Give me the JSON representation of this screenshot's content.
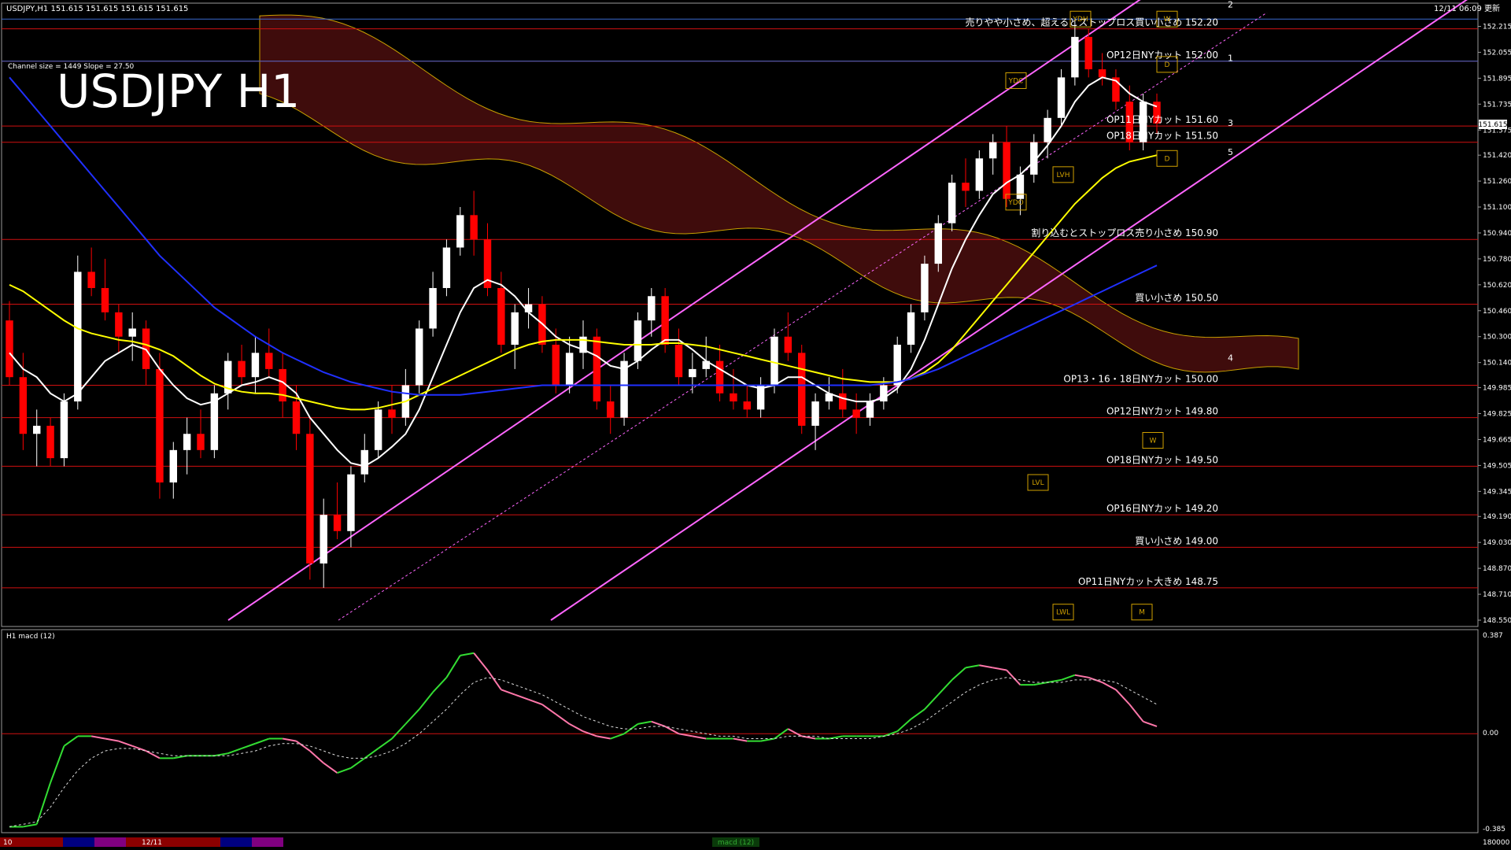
{
  "header": {
    "symbol_info": "USDJPY,H1  151.615 151.615 151.615 151.615",
    "timestamp": "12/11 06:09 更新",
    "channel_info": "Channel size = 1449 Slope = 27.50",
    "big_title": "USDJPY H1"
  },
  "current_price_tag": "151.615",
  "colors": {
    "background": "#000000",
    "bull_candle": "#ffffff",
    "bear_candle": "#ff0000",
    "sma_white": "#ffffff",
    "sma_yellow": "#ffff00",
    "sma_blue": "#2030ff",
    "channel": "#ff66ff",
    "hline": "#d01010",
    "macd_up": "#33dd33",
    "macd_down": "#ff77aa",
    "signal": "#dddddd",
    "kumo": "#8b1a1a"
  },
  "annotations": [
    {
      "label": "売りやや小さめ、超えるとストップロス買い小さめ 152.20",
      "price": 152.2
    },
    {
      "label": "OP12日NYカット 152.00",
      "price": 152.0
    },
    {
      "label": "OP11日NYカット 151.60",
      "price": 151.6
    },
    {
      "label": "OP18日NYカット 151.50",
      "price": 151.5
    },
    {
      "label": "割り込むとストップロス売り小さめ 150.90",
      "price": 150.9
    },
    {
      "label": "買い小さめ 150.50",
      "price": 150.5
    },
    {
      "label": "OP13・16・18日NYカット 150.00",
      "price": 150.0
    },
    {
      "label": "OP12日NYカット 149.80",
      "price": 149.8
    },
    {
      "label": "OP18日NYカット 149.50",
      "price": 149.5
    },
    {
      "label": "OP16日NYカット 149.20",
      "price": 149.2
    },
    {
      "label": "買い小さめ 149.00",
      "price": 149.0
    },
    {
      "label": "OP11日NYカット大きめ 148.75",
      "price": 148.75
    }
  ],
  "level_markers": [
    {
      "label": "YDH",
      "price": 152.26
    },
    {
      "label": "W",
      "price": 152.26
    },
    {
      "label": "YDC",
      "price": 151.88
    },
    {
      "label": "D",
      "price": 151.98
    },
    {
      "label": "LVH",
      "price": 151.3
    },
    {
      "label": "YDO",
      "price": 151.13
    },
    {
      "label": "D",
      "price": 151.4
    },
    {
      "label": "W",
      "price": 149.66
    },
    {
      "label": "LVL",
      "price": 149.4
    },
    {
      "label": "LWL",
      "price": 148.6
    },
    {
      "label": "M",
      "price": 148.6
    }
  ],
  "fib_numbers": [
    {
      "label": "2",
      "price": 152.35
    },
    {
      "label": "1",
      "price": 152.02
    },
    {
      "label": "3",
      "price": 151.62
    },
    {
      "label": "5",
      "price": 151.44
    },
    {
      "label": "4",
      "price": 150.17
    }
  ],
  "macd_panel": {
    "label": "H1  macd (12)",
    "top_value": "0.387",
    "zero_value": "0.00",
    "bottom_value": "-0.385"
  },
  "bottom_bar": {
    "left_date": "10",
    "mid_date": "12/11",
    "center_label": "macd (12)",
    "right_value": "180000"
  },
  "chart_data": {
    "type": "candlestick",
    "title": "USDJPY H1",
    "ylim": [
      148.55,
      152.3
    ],
    "price_ticks": [
      "152.215",
      "152.055",
      "151.895",
      "151.735",
      "151.575",
      "151.420",
      "151.260",
      "151.100",
      "150.940",
      "150.780",
      "150.620",
      "150.460",
      "150.300",
      "150.140",
      "149.985",
      "149.825",
      "149.665",
      "149.505",
      "149.345",
      "149.190",
      "149.030",
      "148.870",
      "148.710",
      "148.550"
    ],
    "candles": [
      [
        150.4,
        150.52,
        150.0,
        150.05
      ],
      [
        150.05,
        150.2,
        149.6,
        149.7
      ],
      [
        149.7,
        149.85,
        149.5,
        149.75
      ],
      [
        149.75,
        149.8,
        149.5,
        149.55
      ],
      [
        149.55,
        149.95,
        149.5,
        149.9
      ],
      [
        149.9,
        150.8,
        149.85,
        150.7
      ],
      [
        150.7,
        150.85,
        150.55,
        150.6
      ],
      [
        150.6,
        150.78,
        150.4,
        150.45
      ],
      [
        150.45,
        150.5,
        150.2,
        150.3
      ],
      [
        150.3,
        150.45,
        150.15,
        150.35
      ],
      [
        150.35,
        150.4,
        150.0,
        150.1
      ],
      [
        150.1,
        150.2,
        149.3,
        149.4
      ],
      [
        149.4,
        149.65,
        149.3,
        149.6
      ],
      [
        149.6,
        149.8,
        149.45,
        149.7
      ],
      [
        149.7,
        149.85,
        149.55,
        149.6
      ],
      [
        149.6,
        150.0,
        149.55,
        149.95
      ],
      [
        149.95,
        150.2,
        149.85,
        150.15
      ],
      [
        150.15,
        150.25,
        150.0,
        150.05
      ],
      [
        150.05,
        150.3,
        149.95,
        150.2
      ],
      [
        150.2,
        150.35,
        150.05,
        150.1
      ],
      [
        150.1,
        150.2,
        149.8,
        149.9
      ],
      [
        149.9,
        150.0,
        149.6,
        149.7
      ],
      [
        149.7,
        149.8,
        148.8,
        148.9
      ],
      [
        148.9,
        149.3,
        148.75,
        149.2
      ],
      [
        149.2,
        149.4,
        149.05,
        149.1
      ],
      [
        149.1,
        149.5,
        149.0,
        149.45
      ],
      [
        149.45,
        149.7,
        149.4,
        149.6
      ],
      [
        149.6,
        149.9,
        149.55,
        149.85
      ],
      [
        149.85,
        150.0,
        149.7,
        149.8
      ],
      [
        149.8,
        150.1,
        149.75,
        150.0
      ],
      [
        150.0,
        150.4,
        149.95,
        150.35
      ],
      [
        150.35,
        150.7,
        150.3,
        150.6
      ],
      [
        150.6,
        150.9,
        150.55,
        150.85
      ],
      [
        150.85,
        151.1,
        150.8,
        151.05
      ],
      [
        151.05,
        151.2,
        150.8,
        150.9
      ],
      [
        150.9,
        151.0,
        150.55,
        150.6
      ],
      [
        150.6,
        150.7,
        150.2,
        150.25
      ],
      [
        150.25,
        150.5,
        150.1,
        150.45
      ],
      [
        150.45,
        150.6,
        150.35,
        150.5
      ],
      [
        150.5,
        150.55,
        150.2,
        150.25
      ],
      [
        150.25,
        150.35,
        149.95,
        150.0
      ],
      [
        150.0,
        150.3,
        149.95,
        150.2
      ],
      [
        150.2,
        150.4,
        150.1,
        150.3
      ],
      [
        150.3,
        150.35,
        149.85,
        149.9
      ],
      [
        149.9,
        150.0,
        149.7,
        149.8
      ],
      [
        149.8,
        150.2,
        149.75,
        150.15
      ],
      [
        150.15,
        150.45,
        150.1,
        150.4
      ],
      [
        150.4,
        150.6,
        150.3,
        150.55
      ],
      [
        150.55,
        150.6,
        150.2,
        150.25
      ],
      [
        150.25,
        150.35,
        150.0,
        150.05
      ],
      [
        150.05,
        150.2,
        149.95,
        150.1
      ],
      [
        150.1,
        150.3,
        150.05,
        150.15
      ],
      [
        150.15,
        150.25,
        149.9,
        149.95
      ],
      [
        149.95,
        150.1,
        149.85,
        149.9
      ],
      [
        149.9,
        150.0,
        149.8,
        149.85
      ],
      [
        149.85,
        150.05,
        149.8,
        150.0
      ],
      [
        150.0,
        150.35,
        149.95,
        150.3
      ],
      [
        150.3,
        150.45,
        150.15,
        150.2
      ],
      [
        150.2,
        150.25,
        149.7,
        149.75
      ],
      [
        149.75,
        149.95,
        149.6,
        149.9
      ],
      [
        149.9,
        150.05,
        149.85,
        149.95
      ],
      [
        149.95,
        150.1,
        149.8,
        149.85
      ],
      [
        149.85,
        149.95,
        149.7,
        149.8
      ],
      [
        149.8,
        149.95,
        149.75,
        149.9
      ],
      [
        149.9,
        150.05,
        149.85,
        150.0
      ],
      [
        150.0,
        150.3,
        149.95,
        150.25
      ],
      [
        150.25,
        150.5,
        150.2,
        150.45
      ],
      [
        150.45,
        150.8,
        150.4,
        150.75
      ],
      [
        150.75,
        151.05,
        150.7,
        151.0
      ],
      [
        151.0,
        151.3,
        150.95,
        151.25
      ],
      [
        151.25,
        151.4,
        151.1,
        151.2
      ],
      [
        151.2,
        151.45,
        151.15,
        151.4
      ],
      [
        151.4,
        151.55,
        151.3,
        151.5
      ],
      [
        151.5,
        151.6,
        151.1,
        151.15
      ],
      [
        151.15,
        151.35,
        151.05,
        151.3
      ],
      [
        151.3,
        151.55,
        151.25,
        151.5
      ],
      [
        151.5,
        151.7,
        151.4,
        151.65
      ],
      [
        151.65,
        151.95,
        151.6,
        151.9
      ],
      [
        151.9,
        152.25,
        151.85,
        152.15
      ],
      [
        152.15,
        152.2,
        151.9,
        151.95
      ],
      [
        151.95,
        152.05,
        151.85,
        151.9
      ],
      [
        151.9,
        151.95,
        151.7,
        151.75
      ],
      [
        151.75,
        151.85,
        151.45,
        151.5
      ],
      [
        151.5,
        151.8,
        151.45,
        151.75
      ],
      [
        151.75,
        151.8,
        151.55,
        151.615
      ]
    ],
    "series": [
      {
        "name": "",
        "color": "#ffffff",
        "values": [
          150.2,
          150.1,
          150.05,
          149.95,
          149.9,
          149.95,
          150.05,
          150.15,
          150.2,
          150.25,
          150.22,
          150.1,
          150.0,
          149.92,
          149.88,
          149.9,
          149.95,
          150.0,
          150.02,
          150.05,
          150.02,
          149.95,
          149.8,
          149.7,
          149.6,
          149.52,
          149.5,
          149.55,
          149.62,
          149.7,
          149.85,
          150.05,
          150.25,
          150.45,
          150.6,
          150.65,
          150.62,
          150.55,
          150.45,
          150.38,
          150.3,
          150.25,
          150.22,
          150.18,
          150.12,
          150.1,
          150.15,
          150.22,
          150.28,
          150.28,
          150.22,
          150.15,
          150.1,
          150.05,
          150.0,
          149.98,
          150.0,
          150.05,
          150.05,
          150.0,
          149.95,
          149.92,
          149.9,
          149.9,
          149.92,
          149.98,
          150.1,
          150.28,
          150.5,
          150.72,
          150.9,
          151.05,
          151.18,
          151.25,
          151.3,
          151.38,
          151.48,
          151.6,
          151.75,
          151.85,
          151.9,
          151.88,
          151.8,
          151.75,
          151.72
        ]
      },
      {
        "name": "",
        "color": "#ffff00",
        "values": [
          150.62,
          150.58,
          150.52,
          150.46,
          150.4,
          150.35,
          150.32,
          150.3,
          150.28,
          150.27,
          150.25,
          150.22,
          150.18,
          150.12,
          150.06,
          150.01,
          149.98,
          149.96,
          149.95,
          149.95,
          149.94,
          149.92,
          149.9,
          149.88,
          149.86,
          149.85,
          149.85,
          149.86,
          149.88,
          149.9,
          149.94,
          149.98,
          150.02,
          150.06,
          150.1,
          150.14,
          150.18,
          150.22,
          150.25,
          150.27,
          150.28,
          150.28,
          150.28,
          150.27,
          150.26,
          150.25,
          150.25,
          150.25,
          150.26,
          150.26,
          150.25,
          150.24,
          150.22,
          150.2,
          150.18,
          150.16,
          150.14,
          150.12,
          150.1,
          150.08,
          150.06,
          150.04,
          150.03,
          150.02,
          150.02,
          150.02,
          150.04,
          150.08,
          150.14,
          150.22,
          150.32,
          150.42,
          150.52,
          150.62,
          150.72,
          150.82,
          150.92,
          151.02,
          151.12,
          151.2,
          151.28,
          151.34,
          151.38,
          151.4,
          151.42
        ]
      },
      {
        "name": "",
        "color": "#2030ff",
        "values": [
          151.9,
          151.8,
          151.7,
          151.6,
          151.5,
          151.4,
          151.3,
          151.2,
          151.1,
          151.0,
          150.9,
          150.8,
          150.72,
          150.64,
          150.56,
          150.48,
          150.42,
          150.36,
          150.3,
          150.25,
          150.2,
          150.16,
          150.12,
          150.08,
          150.05,
          150.02,
          150.0,
          149.98,
          149.96,
          149.95,
          149.94,
          149.94,
          149.94,
          149.94,
          149.95,
          149.96,
          149.97,
          149.98,
          149.99,
          150.0,
          150.0,
          150.0,
          150.0,
          150.0,
          150.0,
          150.0,
          150.0,
          150.0,
          150.0,
          150.0,
          150.0,
          150.0,
          150.0,
          150.0,
          150.0,
          150.0,
          150.0,
          150.0,
          150.0,
          150.0,
          150.0,
          150.0,
          150.0,
          150.0,
          150.01,
          150.02,
          150.04,
          150.07,
          150.1,
          150.14,
          150.18,
          150.22,
          150.26,
          150.3,
          150.34,
          150.38,
          150.42,
          150.46,
          150.5,
          150.54,
          150.58,
          150.62,
          150.66,
          150.7,
          150.74
        ]
      }
    ],
    "macd": {
      "ylim": [
        -0.385,
        0.387
      ],
      "values": [
        -0.38,
        -0.38,
        -0.37,
        -0.2,
        -0.05,
        -0.01,
        -0.01,
        -0.02,
        -0.03,
        -0.05,
        -0.07,
        -0.1,
        -0.1,
        -0.09,
        -0.09,
        -0.09,
        -0.08,
        -0.06,
        -0.04,
        -0.02,
        -0.02,
        -0.03,
        -0.07,
        -0.12,
        -0.16,
        -0.14,
        -0.1,
        -0.06,
        -0.02,
        0.04,
        0.1,
        0.17,
        0.23,
        0.32,
        0.33,
        0.26,
        0.18,
        0.16,
        0.14,
        0.12,
        0.08,
        0.04,
        0.01,
        -0.01,
        -0.02,
        0.0,
        0.04,
        0.05,
        0.03,
        0.0,
        -0.01,
        -0.02,
        -0.02,
        -0.02,
        -0.03,
        -0.03,
        -0.02,
        0.02,
        -0.01,
        -0.02,
        -0.02,
        -0.01,
        -0.01,
        -0.01,
        -0.01,
        0.01,
        0.06,
        0.1,
        0.16,
        0.22,
        0.27,
        0.28,
        0.27,
        0.26,
        0.2,
        0.2,
        0.21,
        0.22,
        0.24,
        0.23,
        0.21,
        0.18,
        0.12,
        0.05,
        0.03
      ],
      "signal": [
        -0.38,
        -0.37,
        -0.36,
        -0.3,
        -0.22,
        -0.15,
        -0.1,
        -0.07,
        -0.06,
        -0.06,
        -0.07,
        -0.08,
        -0.09,
        -0.09,
        -0.09,
        -0.09,
        -0.09,
        -0.08,
        -0.07,
        -0.05,
        -0.04,
        -0.04,
        -0.05,
        -0.07,
        -0.09,
        -0.1,
        -0.1,
        -0.09,
        -0.07,
        -0.04,
        0.0,
        0.05,
        0.1,
        0.16,
        0.21,
        0.23,
        0.22,
        0.2,
        0.18,
        0.16,
        0.13,
        0.1,
        0.07,
        0.05,
        0.03,
        0.02,
        0.02,
        0.03,
        0.03,
        0.02,
        0.01,
        0.0,
        -0.01,
        -0.01,
        -0.02,
        -0.02,
        -0.02,
        -0.01,
        -0.01,
        -0.01,
        -0.02,
        -0.02,
        -0.02,
        -0.02,
        -0.01,
        0.0,
        0.02,
        0.05,
        0.09,
        0.13,
        0.17,
        0.2,
        0.22,
        0.23,
        0.22,
        0.21,
        0.21,
        0.21,
        0.22,
        0.22,
        0.22,
        0.21,
        0.18,
        0.15,
        0.12
      ]
    }
  }
}
